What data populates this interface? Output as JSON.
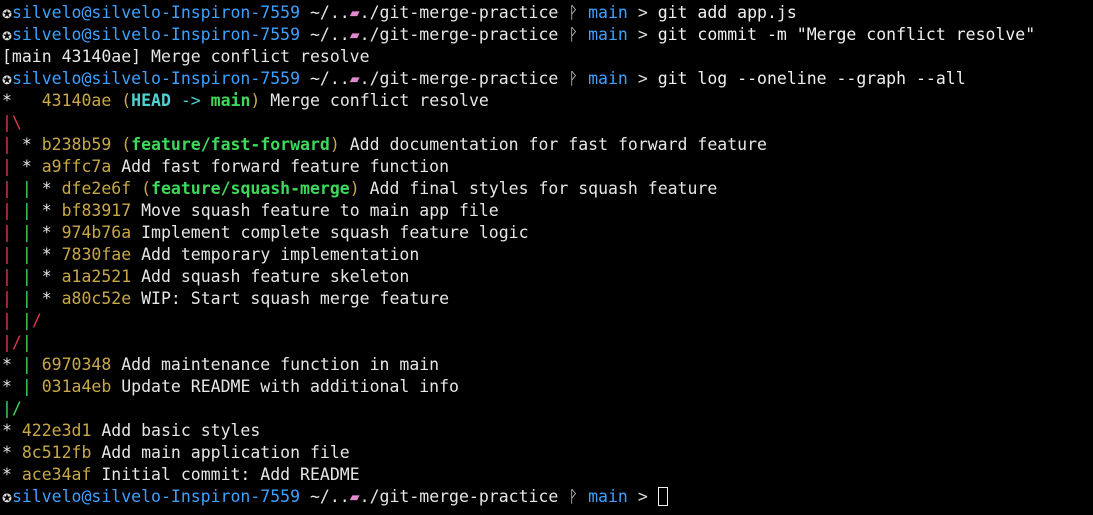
{
  "prompt": {
    "user_host": "silvelo@silvelo-Inspiron-7559",
    "path_prefix": "~/..",
    "path_suffix": "./git-merge-practice",
    "branch": "main",
    "arrow": ">"
  },
  "commands": [
    "git add app.js",
    "git commit -m \"Merge conflict resolve\"",
    "git log --oneline --graph --all"
  ],
  "commit_output": "[main 43140ae] Merge conflict resolve",
  "log": {
    "head_ref": "HEAD",
    "head_arrow": "->",
    "entries": [
      {
        "hash": "43140ae",
        "refs": "main",
        "message": "Merge conflict resolve"
      },
      {
        "hash": "b238b59",
        "refs": "feature/fast-forward",
        "message": "Add documentation for fast forward feature"
      },
      {
        "hash": "a9ffc7a",
        "message": "Add fast forward feature function"
      },
      {
        "hash": "dfe2e6f",
        "refs": "feature/squash-merge",
        "message": "Add final styles for squash feature"
      },
      {
        "hash": "bf83917",
        "message": "Move squash feature to main app file"
      },
      {
        "hash": "974b76a",
        "message": "Implement complete squash feature logic"
      },
      {
        "hash": "7830fae",
        "message": "Add temporary implementation"
      },
      {
        "hash": "a1a2521",
        "message": "Add squash feature skeleton"
      },
      {
        "hash": "a80c52e",
        "message": "WIP: Start squash merge feature"
      },
      {
        "hash": "6970348",
        "message": "Add maintenance function in main"
      },
      {
        "hash": "031a4eb",
        "message": "Update README with additional info"
      },
      {
        "hash": "422e3d1",
        "message": "Add basic styles"
      },
      {
        "hash": "8c512fb",
        "message": "Add main application file"
      },
      {
        "hash": "ace34af",
        "message": "Initial commit: Add README"
      }
    ]
  },
  "colors": {
    "background": "#000000",
    "user_host": "#3da2ff",
    "folder": "#e08bd0",
    "hash": "#c8a847",
    "branch_ref": "#3ed85b",
    "head_ref": "#4fd2d2",
    "graph_red": "#e0384a",
    "graph_green": "#3ed85b",
    "graph_yellow": "#d8c23b"
  },
  "icons": {
    "prompt_icon": "ubuntu-circle-icon",
    "folder_icon": "folder-icon",
    "branch_icon": "git-branch-icon"
  }
}
